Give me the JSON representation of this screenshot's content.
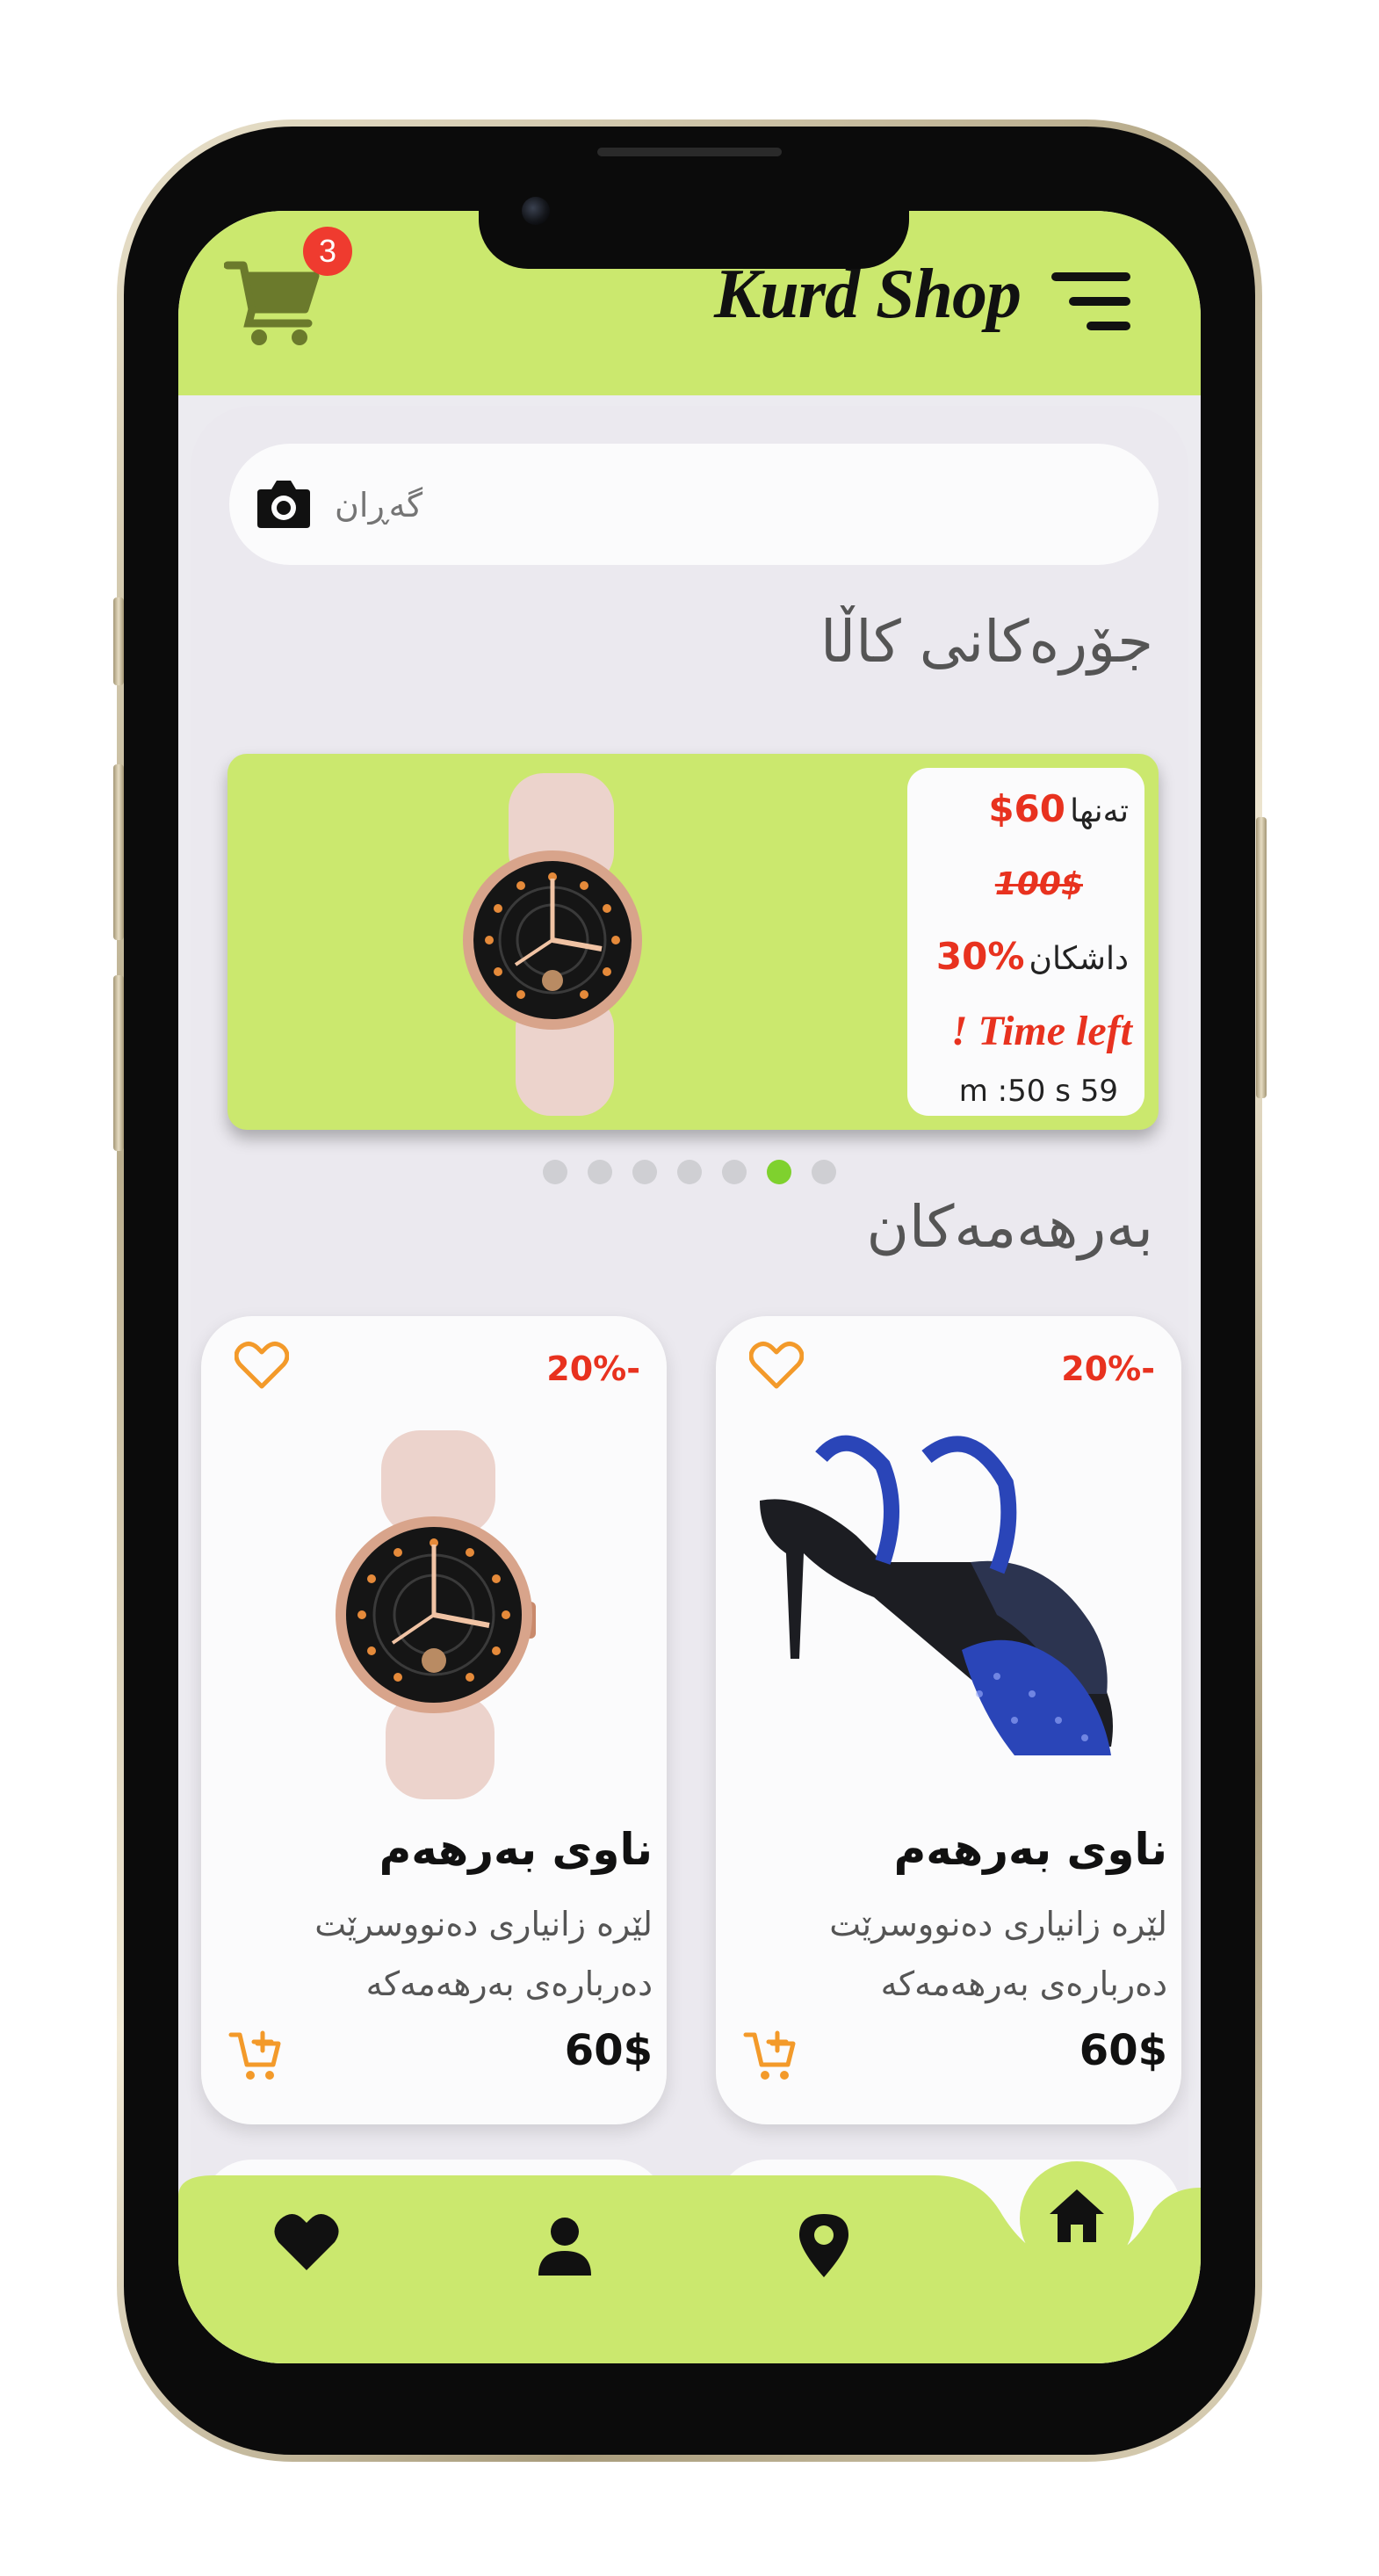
{
  "header": {
    "brand": "Kurd Shop",
    "cart_count": "3"
  },
  "search": {
    "placeholder": "گەڕان"
  },
  "sections": {
    "categories_title": "جۆرەکانی کاڵا",
    "products_title": "بەرهەمەکان"
  },
  "banner": {
    "only_label": "تەنها",
    "new_price": "$60",
    "old_price": "100$",
    "discount_label": "داشکان",
    "discount_value": "30%",
    "time_left": "! Time left",
    "timer": "m :50 s 59",
    "dots_count": 7,
    "active_dot": 5
  },
  "products": [
    {
      "discount": "20%-",
      "name": "ناوی بەرهەم",
      "description": "لێرە زانیاری دەنووسرێت دەربارەی بەرهەمەکە",
      "price": "60$",
      "image": "pink-smartwatch"
    },
    {
      "discount": "20%-",
      "name": "ناوی بەرهەم",
      "description": "لێرە زانیاری دەنووسرێت دەربارەی بەرهەمەکە",
      "price": "60$",
      "image": "blue-high-heel-sandal"
    }
  ],
  "bottom_nav": {
    "items": [
      "favorites",
      "profile",
      "location",
      "home"
    ],
    "active": "home"
  },
  "colors": {
    "accent_green": "#cbe86e",
    "sale_red": "#e8321f",
    "icon_orange": "#f39a2a",
    "badge_red": "#ef3b2f",
    "cart_icon": "#6b7a2c"
  }
}
